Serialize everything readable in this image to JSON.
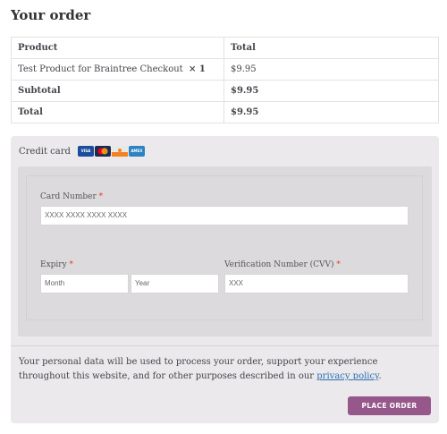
{
  "heading": "Your order",
  "table": {
    "header": {
      "product": "Product",
      "total": "Total"
    },
    "item": {
      "name": "Test Product for Braintree Checkout",
      "qty": "× 1",
      "total": "$9.95"
    },
    "subtotal": {
      "label": "Subtotal",
      "value": "$9.95"
    },
    "total": {
      "label": "Total",
      "value": "$9.95"
    }
  },
  "payment": {
    "method_label": "Credit card",
    "card_icons": [
      "visa-card-icon",
      "mastercard-icon",
      "discover-card-icon",
      "amex-card-icon"
    ],
    "card_brand_text": {
      "visa": "VISA",
      "amex": "AMEX"
    },
    "card_number": {
      "label": "Card Number",
      "required": "*",
      "placeholder": "XXXX XXXX XXXX XXXX"
    },
    "expiry": {
      "label": "Expiry",
      "required": "*",
      "month_placeholder": "Month",
      "year_placeholder": "Year"
    },
    "cvv": {
      "label": "Verification Number (CVV)",
      "required": "*",
      "placeholder": "XXX"
    }
  },
  "privacy": {
    "text": "Your personal data will be used to process your order, support your experience throughout this website, and for other purposes described in our ",
    "link": "privacy policy",
    "end": "."
  },
  "place_order_label": "PLACE ORDER",
  "colors": {
    "accent": "#96588a",
    "link": "#2c6fb5",
    "required": "#e2401c",
    "panel": "#ebe9eb"
  }
}
